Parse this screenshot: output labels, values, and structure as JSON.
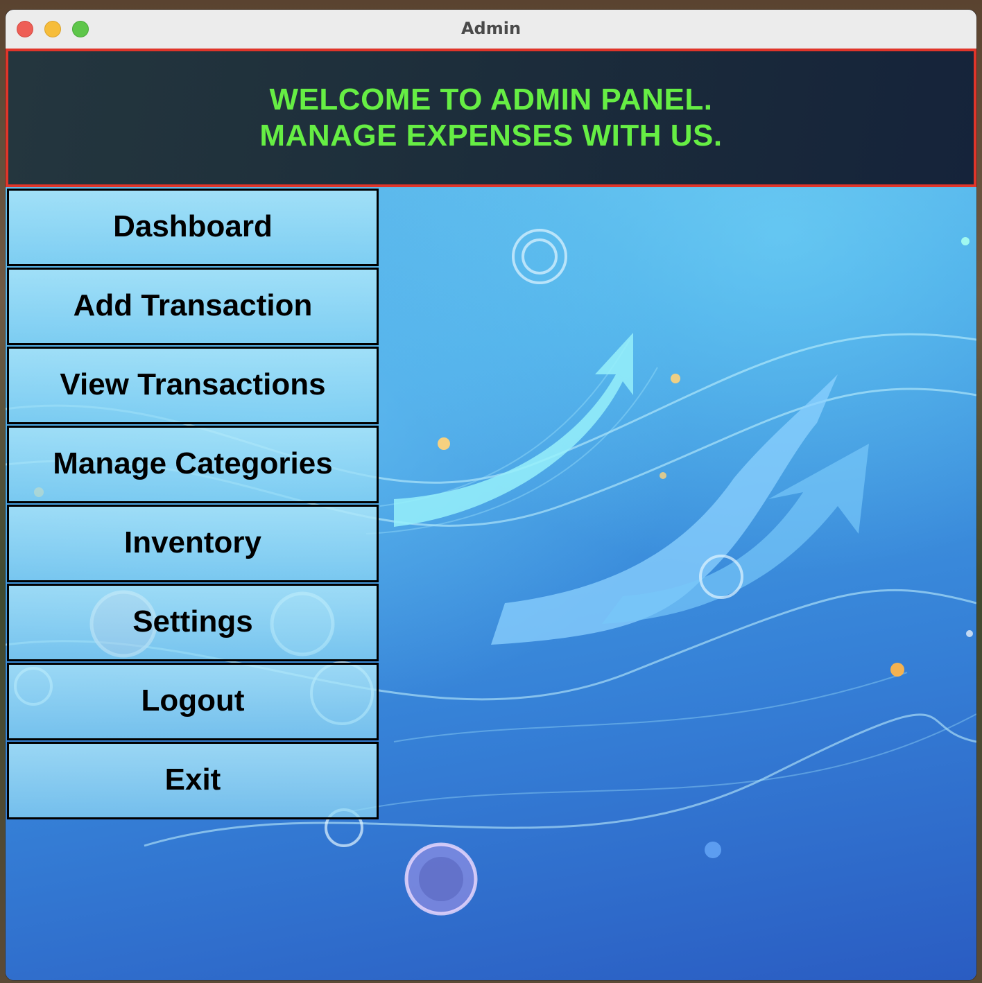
{
  "window": {
    "title": "Admin"
  },
  "header": {
    "line1": "WELCOME TO ADMIN PANEL.",
    "line2": "MANAGE EXPENSES WITH US.",
    "text_color": "#66ee44",
    "border_color": "#e0352a"
  },
  "menu": {
    "items": [
      {
        "label": "Dashboard"
      },
      {
        "label": "Add Transaction"
      },
      {
        "label": "View Transactions"
      },
      {
        "label": "Manage Categories"
      },
      {
        "label": "Inventory"
      },
      {
        "label": "Settings"
      },
      {
        "label": "Logout"
      },
      {
        "label": "Exit"
      }
    ]
  },
  "background": {
    "description_icon": "finance-arrows-background",
    "accent": "#2a6fd0"
  }
}
